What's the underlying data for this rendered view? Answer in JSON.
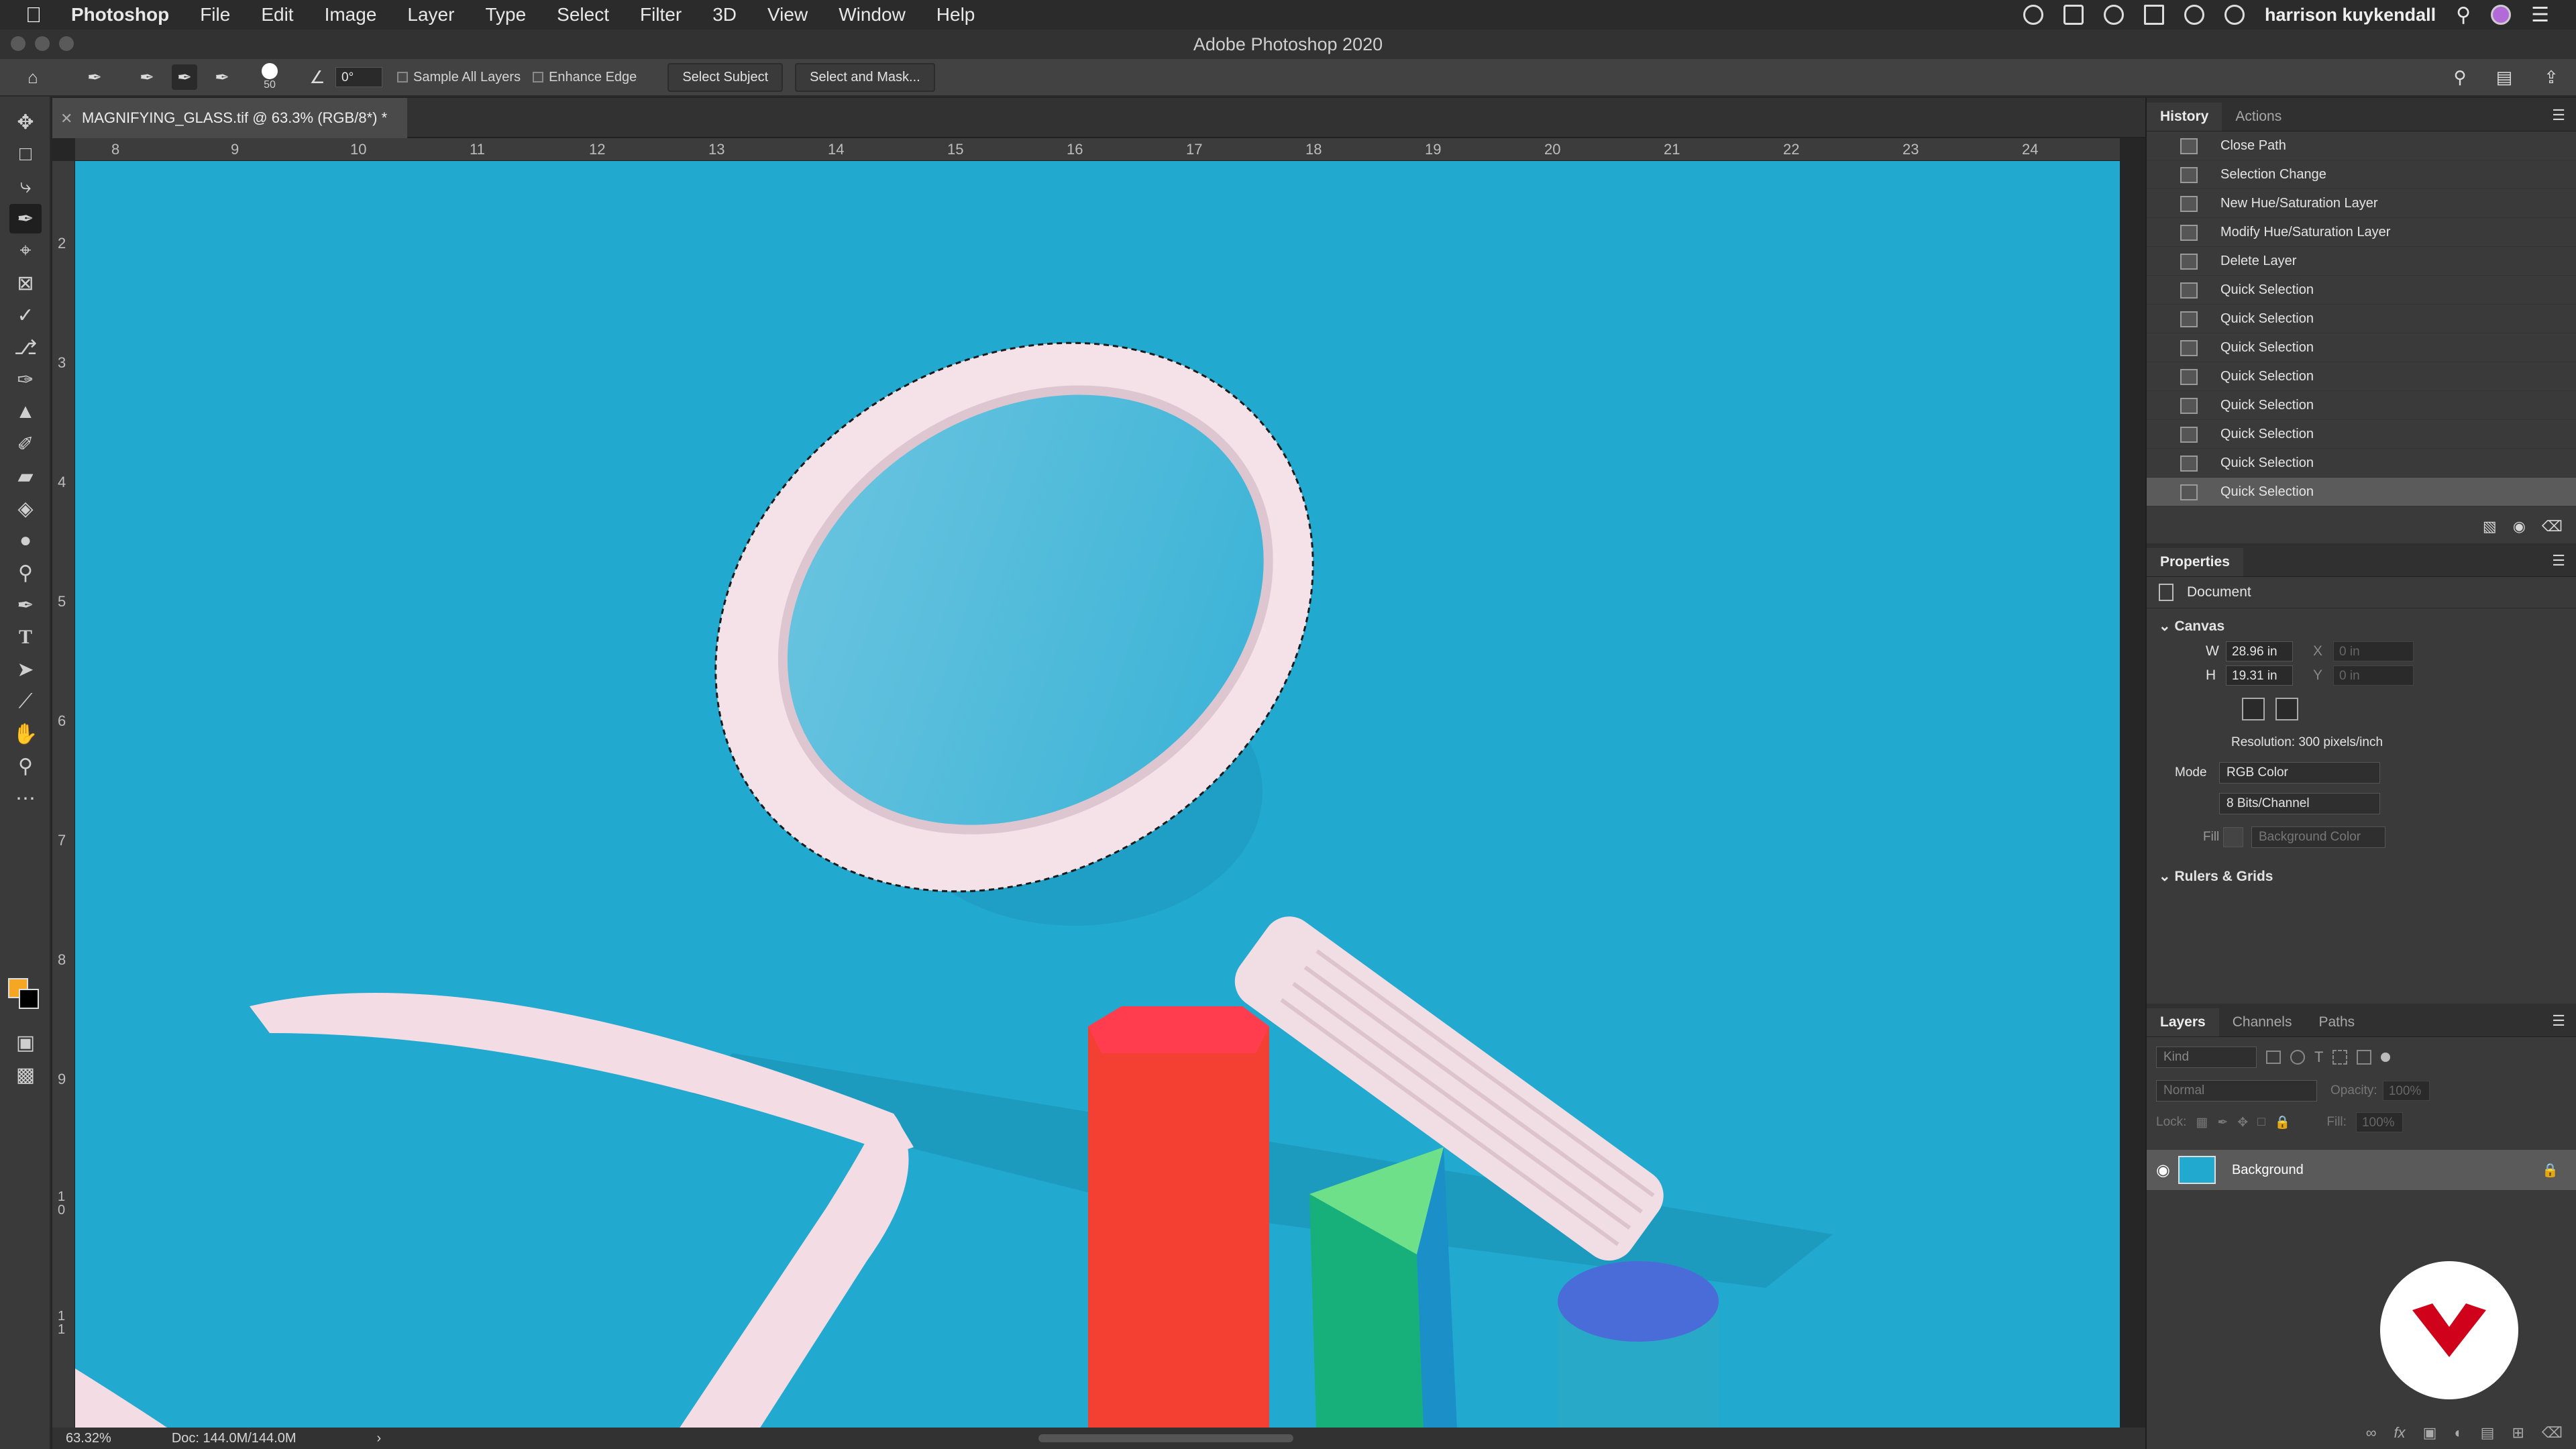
{
  "menubar": {
    "app": "Photoshop",
    "items": [
      "File",
      "Edit",
      "Image",
      "Layer",
      "Type",
      "Select",
      "Filter",
      "3D",
      "View",
      "Window",
      "Help"
    ],
    "user": "harrison kuykendall"
  },
  "window": {
    "title": "Adobe Photoshop 2020"
  },
  "options": {
    "brush_size": "50",
    "angle": "0°",
    "sample_all_layers": "Sample All Layers",
    "enhance_edge": "Enhance Edge",
    "select_subject": "Select Subject",
    "select_and_mask": "Select and Mask..."
  },
  "document": {
    "tab_label": "MAGNIFYING_GLASS.tif @ 63.3% (RGB/8*) *",
    "zoom": "63.32%",
    "doc_size": "Doc: 144.0M/144.0M"
  },
  "ruler": {
    "h_ticks": [
      "8",
      "9",
      "10",
      "11",
      "12",
      "13",
      "14",
      "15",
      "16",
      "17",
      "18",
      "19",
      "20",
      "21",
      "22",
      "23",
      "24"
    ],
    "v_ticks": [
      "2",
      "3",
      "4",
      "5",
      "6",
      "7",
      "8",
      "9",
      "1 0",
      "1 1"
    ]
  },
  "history": {
    "tabs": [
      "History",
      "Actions"
    ],
    "items": [
      "Close Path",
      "Selection Change",
      "New Hue/Saturation Layer",
      "Modify Hue/Saturation Layer",
      "Delete Layer",
      "Quick Selection",
      "Quick Selection",
      "Quick Selection",
      "Quick Selection",
      "Quick Selection",
      "Quick Selection",
      "Quick Selection",
      "Quick Selection"
    ]
  },
  "properties": {
    "title": "Properties",
    "doc_label": "Document",
    "canvas_label": "Canvas",
    "w_label": "W",
    "w": "28.96 in",
    "h_label": "H",
    "h": "19.31 in",
    "x_label": "X",
    "x": "0 in",
    "y_label": "Y",
    "y": "0 in",
    "resolution": "Resolution: 300 pixels/inch",
    "mode_label": "Mode",
    "mode": "RGB Color",
    "bits": "8 Bits/Channel",
    "fill_label": "Fill",
    "fill": "Background Color",
    "rulers_label": "Rulers & Grids"
  },
  "layers": {
    "tabs": [
      "Layers",
      "Channels",
      "Paths"
    ],
    "kind": "Kind",
    "blend": "Normal",
    "opacity_label": "Opacity:",
    "opacity": "100%",
    "lock_label": "Lock:",
    "fill_label": "Fill:",
    "fill": "100%",
    "layer_name": "Background"
  },
  "colors": {
    "foreground": "#f5a623",
    "background": "#000000",
    "canvas": "#22a9cf"
  }
}
